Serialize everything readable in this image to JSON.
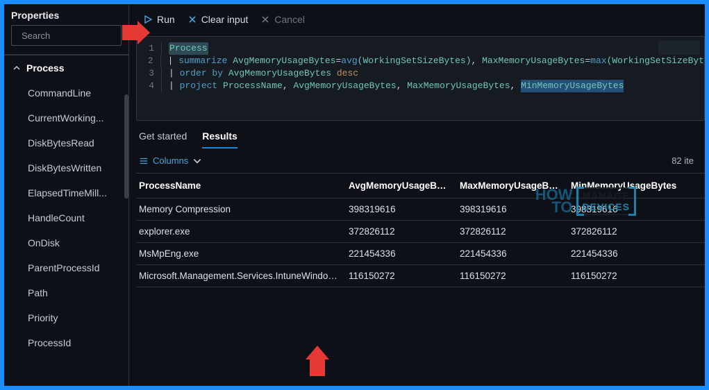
{
  "sidebar": {
    "title": "Properties",
    "search_placeholder": "Search",
    "group": "Process",
    "items": [
      "CommandLine",
      "CurrentWorking...",
      "DiskBytesRead",
      "DiskBytesWritten",
      "ElapsedTimeMill...",
      "HandleCount",
      "OnDisk",
      "ParentProcessId",
      "Path",
      "Priority",
      "ProcessId"
    ]
  },
  "toolbar": {
    "run": "Run",
    "clear": "Clear input",
    "cancel": "Cancel"
  },
  "query": {
    "line1_a": "Process",
    "line2_pipe": "| ",
    "line2_kw": "summarize",
    "line2_c1": " AvgMemoryUsageBytes",
    "line2_eq1": "=",
    "line2_fn1": "avg",
    "line2_ar1": "(WorkingSetSizeBytes)",
    "line2_com": ", ",
    "line2_c2": "MaxMemoryUsageBytes",
    "line2_eq2": "=",
    "line2_fn2": "max",
    "line2_ar2": "(WorkingSetSizeByt",
    "line3_pipe": "| ",
    "line3_kw1": "order ",
    "line3_kw2": "by",
    "line3_c": " AvgMemoryUsageBytes ",
    "line3_dir": "desc",
    "line4_pipe": "| ",
    "line4_kw": "project",
    "line4_c1": " ProcessName",
    "line4_s1": ", ",
    "line4_c2": "AvgMemoryUsageBytes",
    "line4_s2": ", ",
    "line4_c3": "MaxMemoryUsageBytes",
    "line4_s3": ", ",
    "line4_c4": "MinMemoryUsageBytes"
  },
  "tabs": {
    "get_started": "Get started",
    "results": "Results"
  },
  "results": {
    "columns_label": "Columns",
    "count_label": "82 ite",
    "headers": [
      "ProcessName",
      "AvgMemoryUsageByt...",
      "MaxMemoryUsageByt...",
      "MinMemoryUsageBytes"
    ],
    "rows": [
      {
        "name": "Memory Compression",
        "avg": "398319616",
        "max": "398319616",
        "min": "398319616"
      },
      {
        "name": "explorer.exe",
        "avg": "372826112",
        "max": "372826112",
        "min": "372826112"
      },
      {
        "name": "MsMpEng.exe",
        "avg": "221454336",
        "max": "221454336",
        "min": "221454336"
      },
      {
        "name": "Microsoft.Management.Services.IntuneWindowsAgent....",
        "avg": "116150272",
        "max": "116150272",
        "min": "116150272"
      }
    ]
  },
  "watermark": {
    "how": "HOW",
    "to": "TO",
    "manage": "MANAGE",
    "devices": "DEVICES"
  }
}
